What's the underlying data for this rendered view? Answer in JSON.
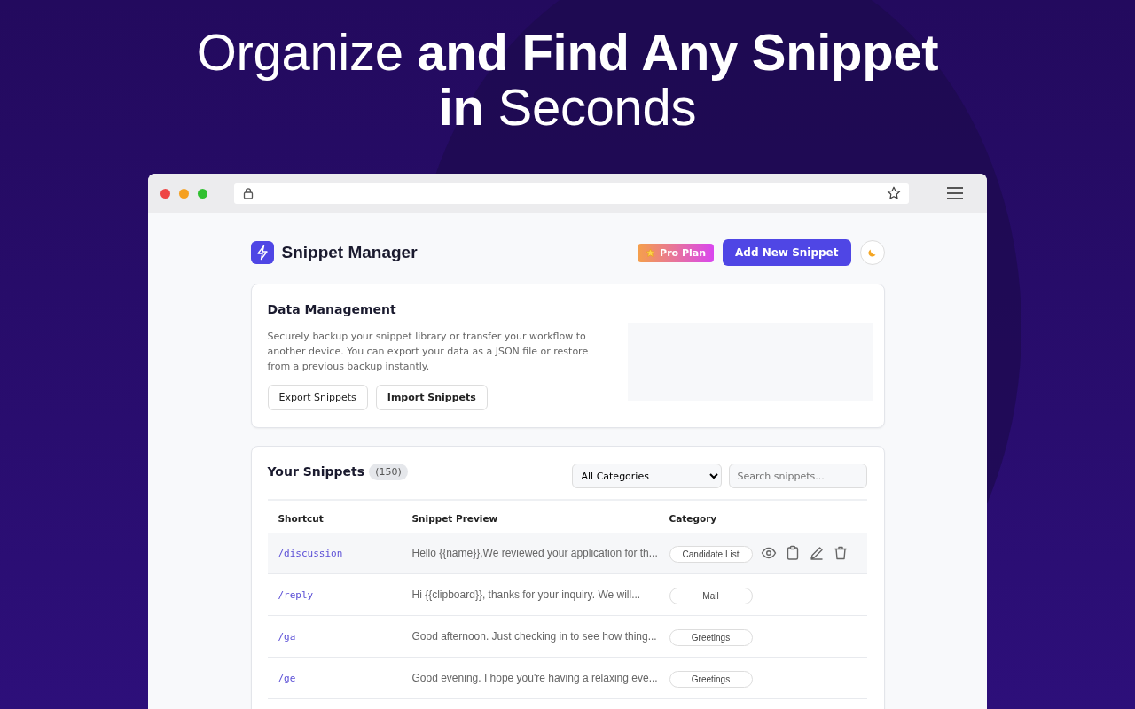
{
  "headline": "Organize **and Find Any Snippet** **in** Seconds",
  "browser": {
    "starred": false
  },
  "app": {
    "title": "Snippet Manager",
    "plan_badge": "Pro Plan",
    "add_button": "Add New Snippet"
  },
  "data_management": {
    "title": "Data Management",
    "description": "Securely backup your snippet library or transfer your workflow to another device. You can export your data as a JSON file or restore from a previous backup instantly.",
    "buttons": [
      "Export Snippets",
      "Import Snippets"
    ]
  },
  "snippets": {
    "title": "Your Snippets",
    "count": "(150)",
    "category_filter": "All Categories",
    "search": {
      "placeholder": "Search snippets..."
    },
    "columns": [
      "Shortcut",
      "Snippet Preview",
      "Category"
    ],
    "rows": [
      {
        "shortcut": "/discussion",
        "preview": "Hello {{name}},We reviewed your application for th...",
        "category": "Candidate List",
        "hovered": true
      },
      {
        "shortcut": "/reply",
        "preview": "Hi {{clipboard}}, thanks for your inquiry. We will...",
        "category": "Mail",
        "hovered": false
      },
      {
        "shortcut": "/ga",
        "preview": "Good afternoon. Just checking in to see how thing...",
        "category": "Greetings",
        "hovered": false
      },
      {
        "shortcut": "/ge",
        "preview": "Good evening. I hope you're having a relaxing eve...",
        "category": "Greetings",
        "hovered": false
      }
    ]
  }
}
